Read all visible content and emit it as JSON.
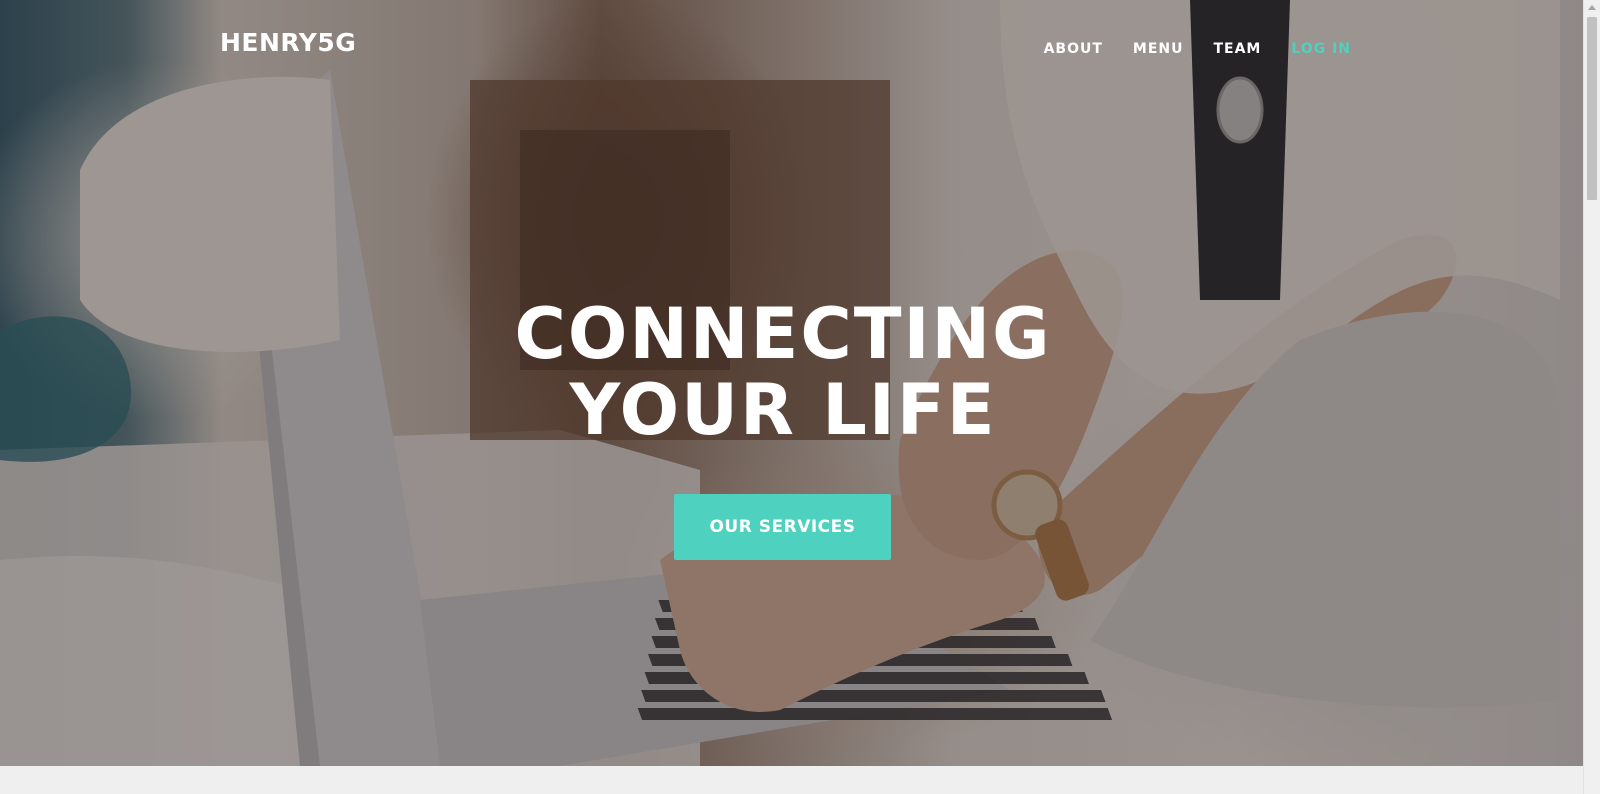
{
  "nav": {
    "brand": "HENRY5G",
    "links": [
      {
        "label": "ABOUT",
        "active": false
      },
      {
        "label": "MENU",
        "active": false
      },
      {
        "label": "TEAM",
        "active": false
      },
      {
        "label": "LOG IN",
        "active": true
      }
    ]
  },
  "hero": {
    "headline_line1": "CONNECTING",
    "headline_line2": "YOUR LIFE",
    "cta_label": "OUR SERVICES",
    "background_image": "woman-typing-on-laptop-photo"
  },
  "colors": {
    "accent": "#4fd1c0",
    "text": "#ffffff",
    "overlay": "rgba(40,32,32,0.42)"
  }
}
